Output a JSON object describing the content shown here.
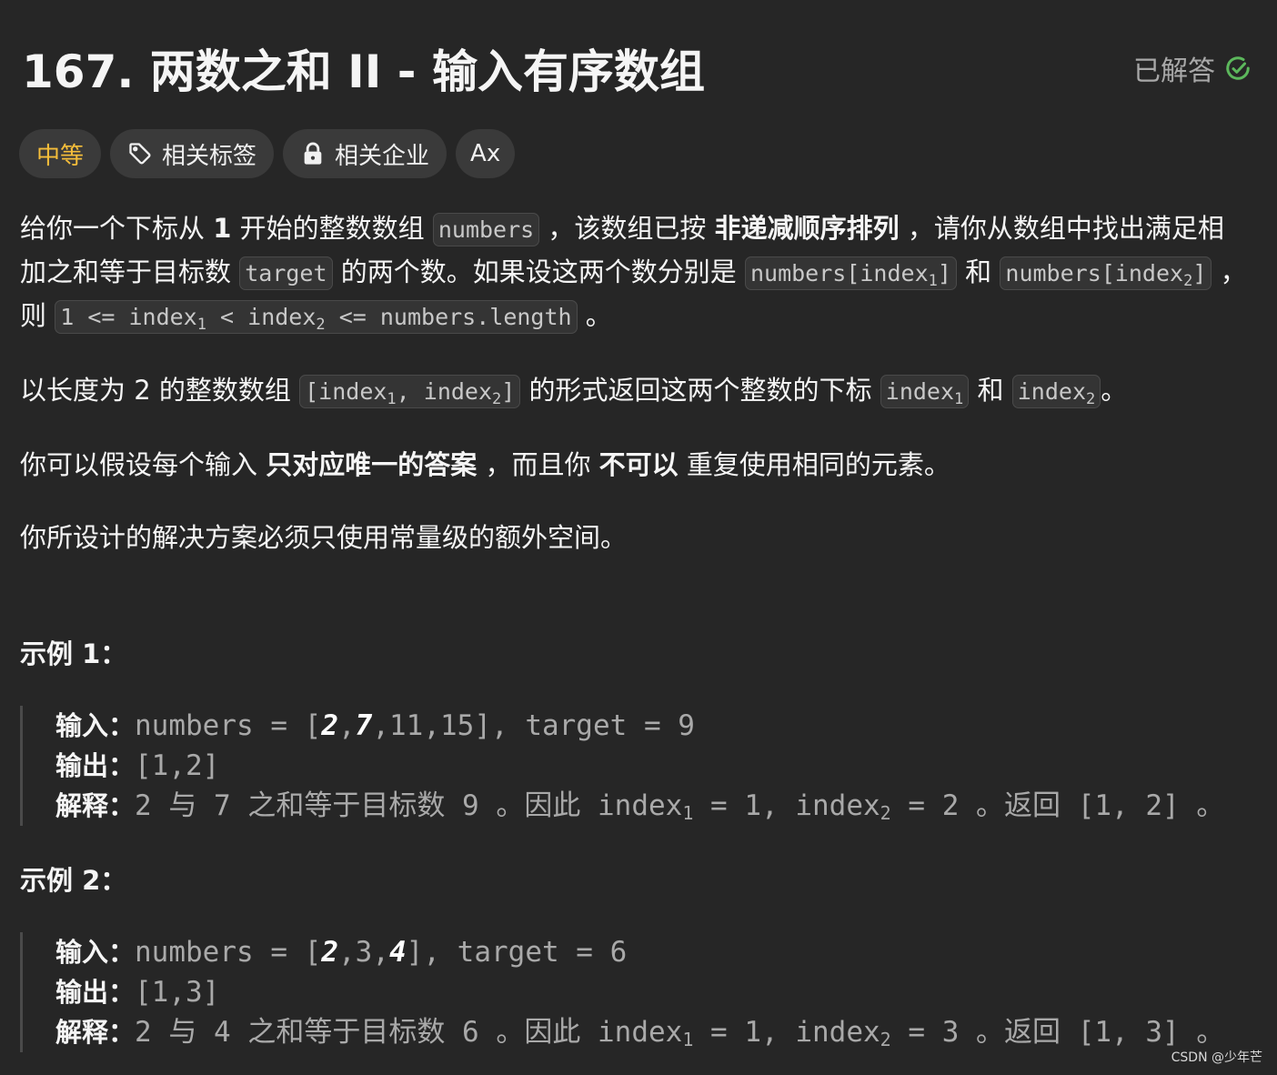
{
  "header": {
    "title": "167. 两数之和 II - 输入有序数组",
    "solved_label": "已解答",
    "solved_icon": "check-circle-icon",
    "solved_color": "#5cb85c"
  },
  "tags": {
    "difficulty": "中等",
    "difficulty_color": "#f4bd3a",
    "topics": "相关标签",
    "companies": "相关企业",
    "font_toggle": "Ax"
  },
  "description": {
    "p1": {
      "t1": "给你一个下标从 ",
      "b1": "1",
      "t2": " 开始的整数数组 ",
      "c1": "numbers",
      "t3": " ，该数组已按 ",
      "b2": "非递减顺序排列",
      "t4": " ，请你从数组中找出满足相加之和等于目标数 ",
      "c2": "target",
      "t5": " 的两个数。如果设这两个数分别是 ",
      "c3a": "numbers[index",
      "c3s": "1",
      "c3b": "]",
      "t6": " 和 ",
      "c4a": "numbers[index",
      "c4s": "2",
      "c4b": "]",
      "t7": " ，则 ",
      "c5a": "1 <= index",
      "c5s1": "1",
      "c5b": " < index",
      "c5s2": "2",
      "c5c": " <= numbers.length",
      "t8": " 。"
    },
    "p2": {
      "t1": "以长度为 2 的整数数组 ",
      "c1a": "[index",
      "c1s1": "1",
      "c1b": ", index",
      "c1s2": "2",
      "c1c": "]",
      "t2": " 的形式返回这两个整数的下标 ",
      "c2a": "index",
      "c2s": "1",
      "t3": " 和 ",
      "c3a": "index",
      "c3s": "2",
      "t4": "。"
    },
    "p3": {
      "t1": "你可以假设每个输入 ",
      "b1": "只对应唯一的答案",
      "t2": " ，而且你 ",
      "b2": "不可以",
      "t3": " 重复使用相同的元素。"
    },
    "p4": "你所设计的解决方案必须只使用常量级的额外空间。"
  },
  "examples": [
    {
      "title": "示例 1：",
      "input_label": "输入：",
      "input": {
        "a": "numbers = [",
        "h1": "2",
        "c1": ",",
        "h2": "7",
        "rest": ",11,15], target = 9"
      },
      "output_label": "输出：",
      "output": "[1,2]",
      "explain_label": "解释：",
      "explain": {
        "a": "2 与 7 之和等于目标数 9 。因此 index",
        "s1": "1",
        "b": " = 1, index",
        "s2": "2",
        "c": " = 2 。返回 [1, 2] 。"
      }
    },
    {
      "title": "示例 2：",
      "input_label": "输入：",
      "input": {
        "a": "numbers = [",
        "h1": "2",
        "c1": ",3,",
        "h2": "4",
        "rest": "], target = 6"
      },
      "output_label": "输出：",
      "output": "[1,3]",
      "explain_label": "解释：",
      "explain": {
        "a": "2 与 4 之和等于目标数 6 。因此 index",
        "s1": "1",
        "b": " = 1, index",
        "s2": "2",
        "c": " = 3 。返回 [1, 3] 。"
      }
    }
  ],
  "watermark": "CSDN @少年芒"
}
